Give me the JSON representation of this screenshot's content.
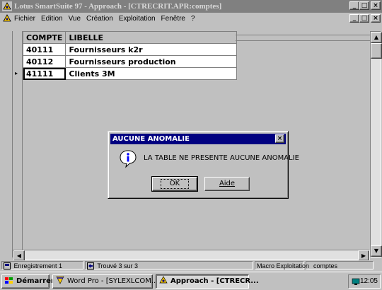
{
  "window": {
    "title": "Lotus SmartSuite 97   - Approach - [CTRECRIT.APR:comptes]",
    "min_glyph": "_",
    "max_glyph": "□",
    "close_glyph": "×"
  },
  "menu": {
    "items": [
      "Fichier",
      "Edition",
      "Vue",
      "Création",
      "Exploitation",
      "Fenêtre",
      "?"
    ],
    "min_glyph": "_",
    "restore_glyph": "□",
    "close_glyph": "×"
  },
  "table": {
    "columns": [
      "COMPTE",
      "LIBELLE"
    ],
    "rows": [
      {
        "compte": "40111",
        "libelle": "Fournisseurs k2r"
      },
      {
        "compte": "40112",
        "libelle": "Fournisseurs production"
      },
      {
        "compte": "41111",
        "libelle": "Clients 3M"
      }
    ],
    "current_row_marker": "▸"
  },
  "dialog": {
    "title": "AUCUNE ANOMALIE",
    "message": "LA TABLE  NE PRESENTE AUCUNE ANOMALIE",
    "ok_label": "OK",
    "help_label": "Aide",
    "close_glyph": "×"
  },
  "status": {
    "mode": "Enregistrement 1",
    "found": "Trouvé 3 sur 3",
    "macro": "Macro Exploitation",
    "view": "comptes"
  },
  "taskbar": {
    "start": "Démarrer",
    "word": "Word Pro - [SYLEXLCOM...",
    "approach": "Approach - [CTRECR...",
    "clock": "12:05"
  },
  "colors": {
    "dialog_title": "#000080",
    "face": "#c0c0c0",
    "inactive_title": "#808080"
  }
}
